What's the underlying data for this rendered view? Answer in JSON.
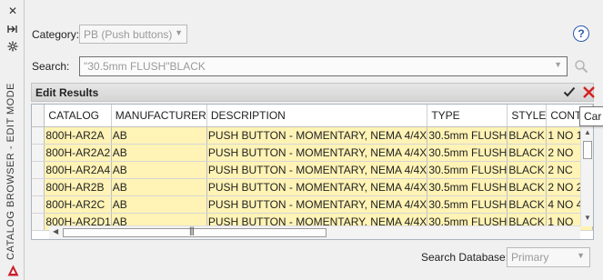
{
  "palette": {
    "title": "CATALOG BROWSER - EDIT MODE",
    "icons": [
      "close-icon",
      "pin-icon",
      "settings-icon"
    ]
  },
  "category": {
    "label": "Category:",
    "value": "PB (Push buttons)"
  },
  "search": {
    "label": "Search:",
    "value": "\"30.5mm FLUSH\"BLACK"
  },
  "edit_results": {
    "title": "Edit Results"
  },
  "tooltip": {
    "text": "Car"
  },
  "grid": {
    "columns": [
      "CATALOG",
      "MANUFACTURER",
      "DESCRIPTION",
      "TYPE",
      "STYLE",
      "CONTA"
    ],
    "rows": [
      [
        "800H-AR2A",
        "AB",
        "PUSH BUTTON - MOMENTARY, NEMA 4/4X",
        "30.5mm FLUSH",
        "BLACK",
        "1 NO 1"
      ],
      [
        "800H-AR2A2",
        "AB",
        "PUSH BUTTON - MOMENTARY, NEMA 4/4X",
        "30.5mm FLUSH",
        "BLACK",
        "2 NO"
      ],
      [
        "800H-AR2A4",
        "AB",
        "PUSH BUTTON - MOMENTARY, NEMA 4/4X",
        "30.5mm FLUSH",
        "BLACK",
        "2 NC"
      ],
      [
        "800H-AR2B",
        "AB",
        "PUSH BUTTON - MOMENTARY, NEMA 4/4X",
        "30.5mm FLUSH",
        "BLACK",
        "2 NO 2"
      ],
      [
        "800H-AR2C",
        "AB",
        "PUSH BUTTON - MOMENTARY, NEMA 4/4X",
        "30.5mm FLUSH",
        "BLACK",
        "4 NO 4"
      ],
      [
        "800H-AR2D1",
        "AB",
        "PUSH BUTTON - MOMENTARY, NEMA 4/4X",
        "30.5mm FLUSH",
        "BLACK",
        "1 NO"
      ]
    ],
    "row_highlight_color": "#fff3b5"
  },
  "database": {
    "label": "Search Database:",
    "value": "Primary"
  },
  "colors": {
    "help_accent": "#2a58a8",
    "cancel_red": "#d42020"
  }
}
